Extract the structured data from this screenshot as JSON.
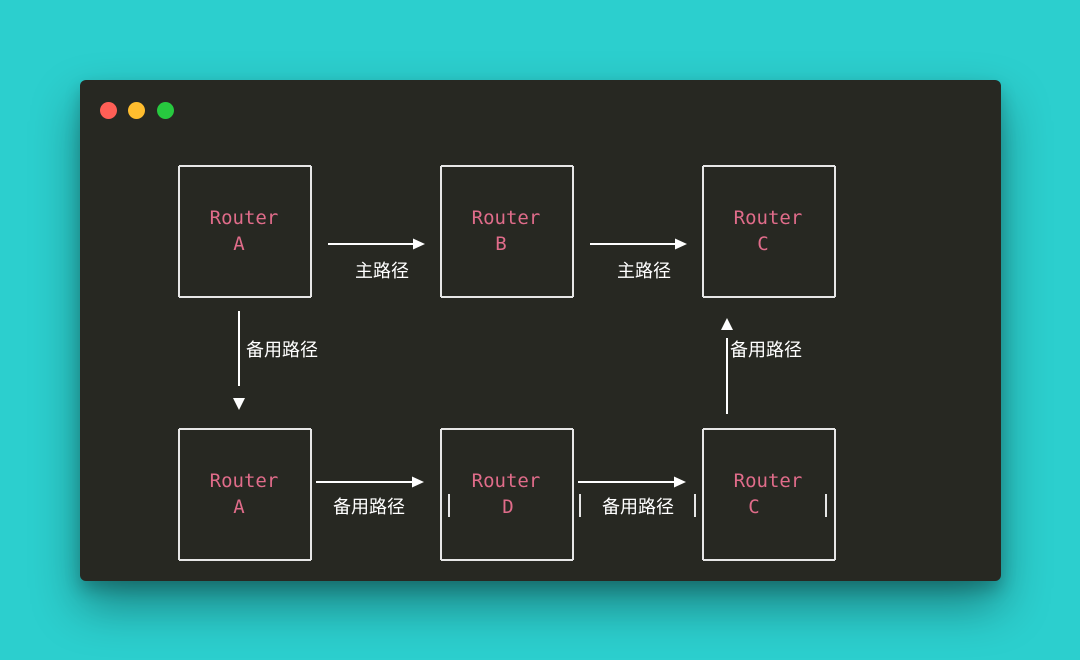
{
  "window": {
    "controls": [
      {
        "name": "close-button",
        "color": "#ff5f56"
      },
      {
        "name": "minimize-button",
        "color": "#ffbd2e"
      },
      {
        "name": "maximize-button",
        "color": "#27c93f"
      }
    ]
  },
  "colors": {
    "background": "#2ccfce",
    "terminal": "#272822",
    "router_text": "#e06c8a",
    "line": "#e6e6e6"
  },
  "routers": {
    "top_a": {
      "line1": "Router",
      "line2": "A"
    },
    "top_b": {
      "line1": "Router",
      "line2": "B"
    },
    "top_c": {
      "line1": "Router",
      "line2": "C"
    },
    "bottom_a": {
      "line1": "Router",
      "line2": "A"
    },
    "bottom_d": {
      "line1": "Router",
      "line2": "D"
    },
    "bottom_c": {
      "line1": "Router",
      "line2": "C"
    }
  },
  "edges": {
    "a_to_b": "主路径",
    "b_to_c": "主路径",
    "a_down": "备用路径",
    "c_up": "备用路径",
    "a_to_d": "备用路径",
    "d_to_c": "备用路径"
  }
}
